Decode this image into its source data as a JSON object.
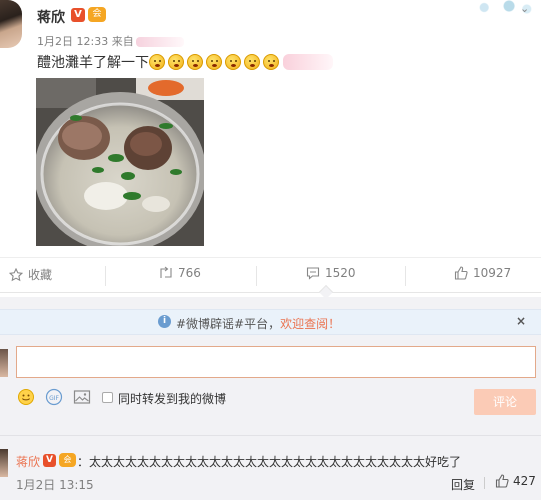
{
  "post": {
    "author": "蒋欣",
    "verified_badge": "V",
    "vip_badge": "会",
    "time": "1月2日 12:33",
    "source_prefix": "来自",
    "text": "醴池灘羊了解一下",
    "emoji_count": 7,
    "emoji_icon": "grinning-face-icon"
  },
  "actions": {
    "favorite_label": "收藏",
    "repost_count": "766",
    "comment_count": "1520",
    "like_count": "10927"
  },
  "notice": {
    "prefix": "#微博辟谣#平台，",
    "link": "欢迎查阅！",
    "close": "×"
  },
  "composer": {
    "input_value": "",
    "also_repost_label": "同时转发到我的微博",
    "submit_label": "评论"
  },
  "comment": {
    "author": "蒋欣",
    "verified_badge": "V",
    "vip_badge": "会",
    "text": "：太太太太太太太太太太太太太太太太太太太太太太太太太太太太好吃了",
    "time": "1月2日 13:15",
    "reply_label": "回复",
    "like_count": "427"
  },
  "colors": {
    "accent": "#eb7350",
    "notice_bg": "#eaf2fa",
    "panel_bg": "#f2f2f5",
    "submit_disabled": "#fbcbb6"
  }
}
